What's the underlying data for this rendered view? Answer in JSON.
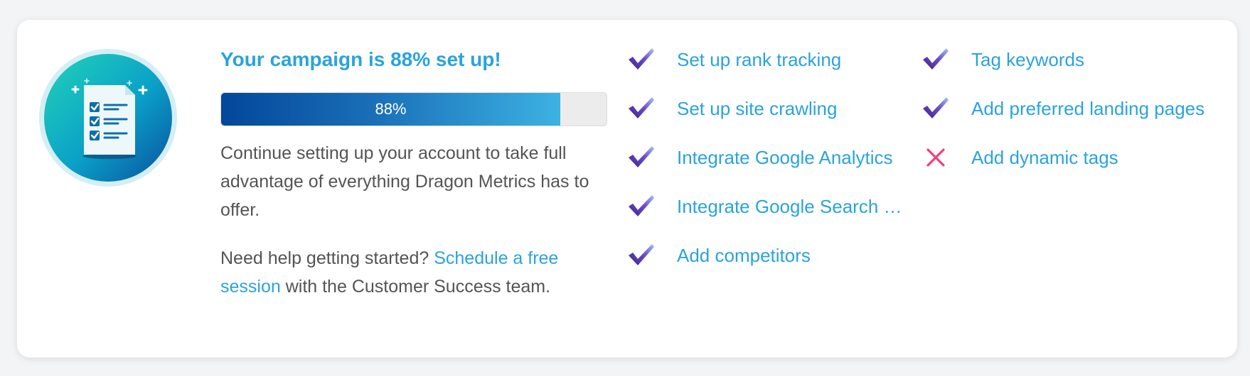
{
  "campaign": {
    "headline": "Your campaign is 88% set up!",
    "progress_percent": 88,
    "progress_label": "88%",
    "description": "Continue setting up your account to take full advantage of everything Dragon Metrics has to offer.",
    "help_prefix": "Need help getting started? ",
    "help_link": "Schedule a free session",
    "help_suffix": " with the Customer Success team."
  },
  "tasks": {
    "column1": [
      {
        "label": "Set up rank tracking",
        "status": "done",
        "icon": "check-icon"
      },
      {
        "label": "Set up site crawling",
        "status": "done",
        "icon": "check-icon"
      },
      {
        "label": "Integrate Google Analytics",
        "status": "done",
        "icon": "check-icon"
      },
      {
        "label": "Integrate Google Search Console",
        "status": "done",
        "icon": "check-icon"
      },
      {
        "label": "Add competitors",
        "status": "done",
        "icon": "check-icon"
      }
    ],
    "column2": [
      {
        "label": "Tag keywords",
        "status": "done",
        "icon": "check-icon"
      },
      {
        "label": "Add preferred landing pages",
        "status": "done",
        "icon": "check-icon"
      },
      {
        "label": "Add dynamic tags",
        "status": "todo",
        "icon": "x-icon"
      }
    ]
  },
  "colors": {
    "accent": "#2aa3dd",
    "text": "#545454",
    "check": "#5a3fb0",
    "cross": "#ec407a",
    "progress_start": "#03479a",
    "progress_end": "#3cb2e3"
  },
  "illustration": {
    "icon": "checklist-document-icon"
  }
}
